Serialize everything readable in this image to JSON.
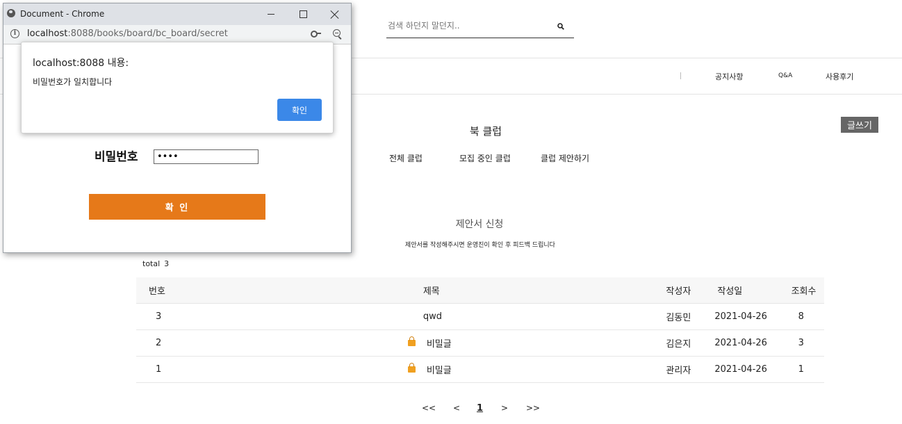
{
  "search": {
    "placeholder": "검색 하던지 말던지.."
  },
  "nav": {
    "separator": "|",
    "items": [
      "공지사항",
      "Q&A",
      "사용후기"
    ]
  },
  "write_button": "글쓰기",
  "club": {
    "title": "북 클럽",
    "tabs": [
      "전체 클럽",
      "모집 중인 클럽",
      "클럽 제안하기"
    ]
  },
  "section": {
    "title": "제안서 신청",
    "desc": "제안서를 작성해주시면 운영진이 확인 후 피드백 드립니다"
  },
  "total": {
    "label": "total",
    "count": "3"
  },
  "table": {
    "headers": [
      "번호",
      "제목",
      "작성자",
      "작성일",
      "조회수"
    ],
    "rows": [
      {
        "no": "3",
        "title": "qwd",
        "writer": "김동민",
        "date": "2021-04-26",
        "views": "8",
        "locked": false
      },
      {
        "no": "2",
        "title": "비밀글",
        "writer": "김은지",
        "date": "2021-04-26",
        "views": "3",
        "locked": true
      },
      {
        "no": "1",
        "title": "비밀글",
        "writer": "관리자",
        "date": "2021-04-26",
        "views": "1",
        "locked": true
      }
    ]
  },
  "pagination": {
    "first": "<<",
    "prev": "<",
    "current": "1",
    "next": ">",
    "last": ">>"
  },
  "popup": {
    "window_title": "Document - Chrome",
    "url_host": "localhost",
    "url_rest": ":8088/books/board/bc_board/secret",
    "password_label": "비밀번호",
    "password_value": "••••",
    "confirm_label": "확 인"
  },
  "alert": {
    "title": "localhost:8088 내용:",
    "message": "비밀번호가 일치합니다",
    "ok_label": "확인"
  },
  "colors": {
    "confirm_orange": "#e67919",
    "alert_blue": "#3b88e8",
    "write_gray": "#666666"
  }
}
